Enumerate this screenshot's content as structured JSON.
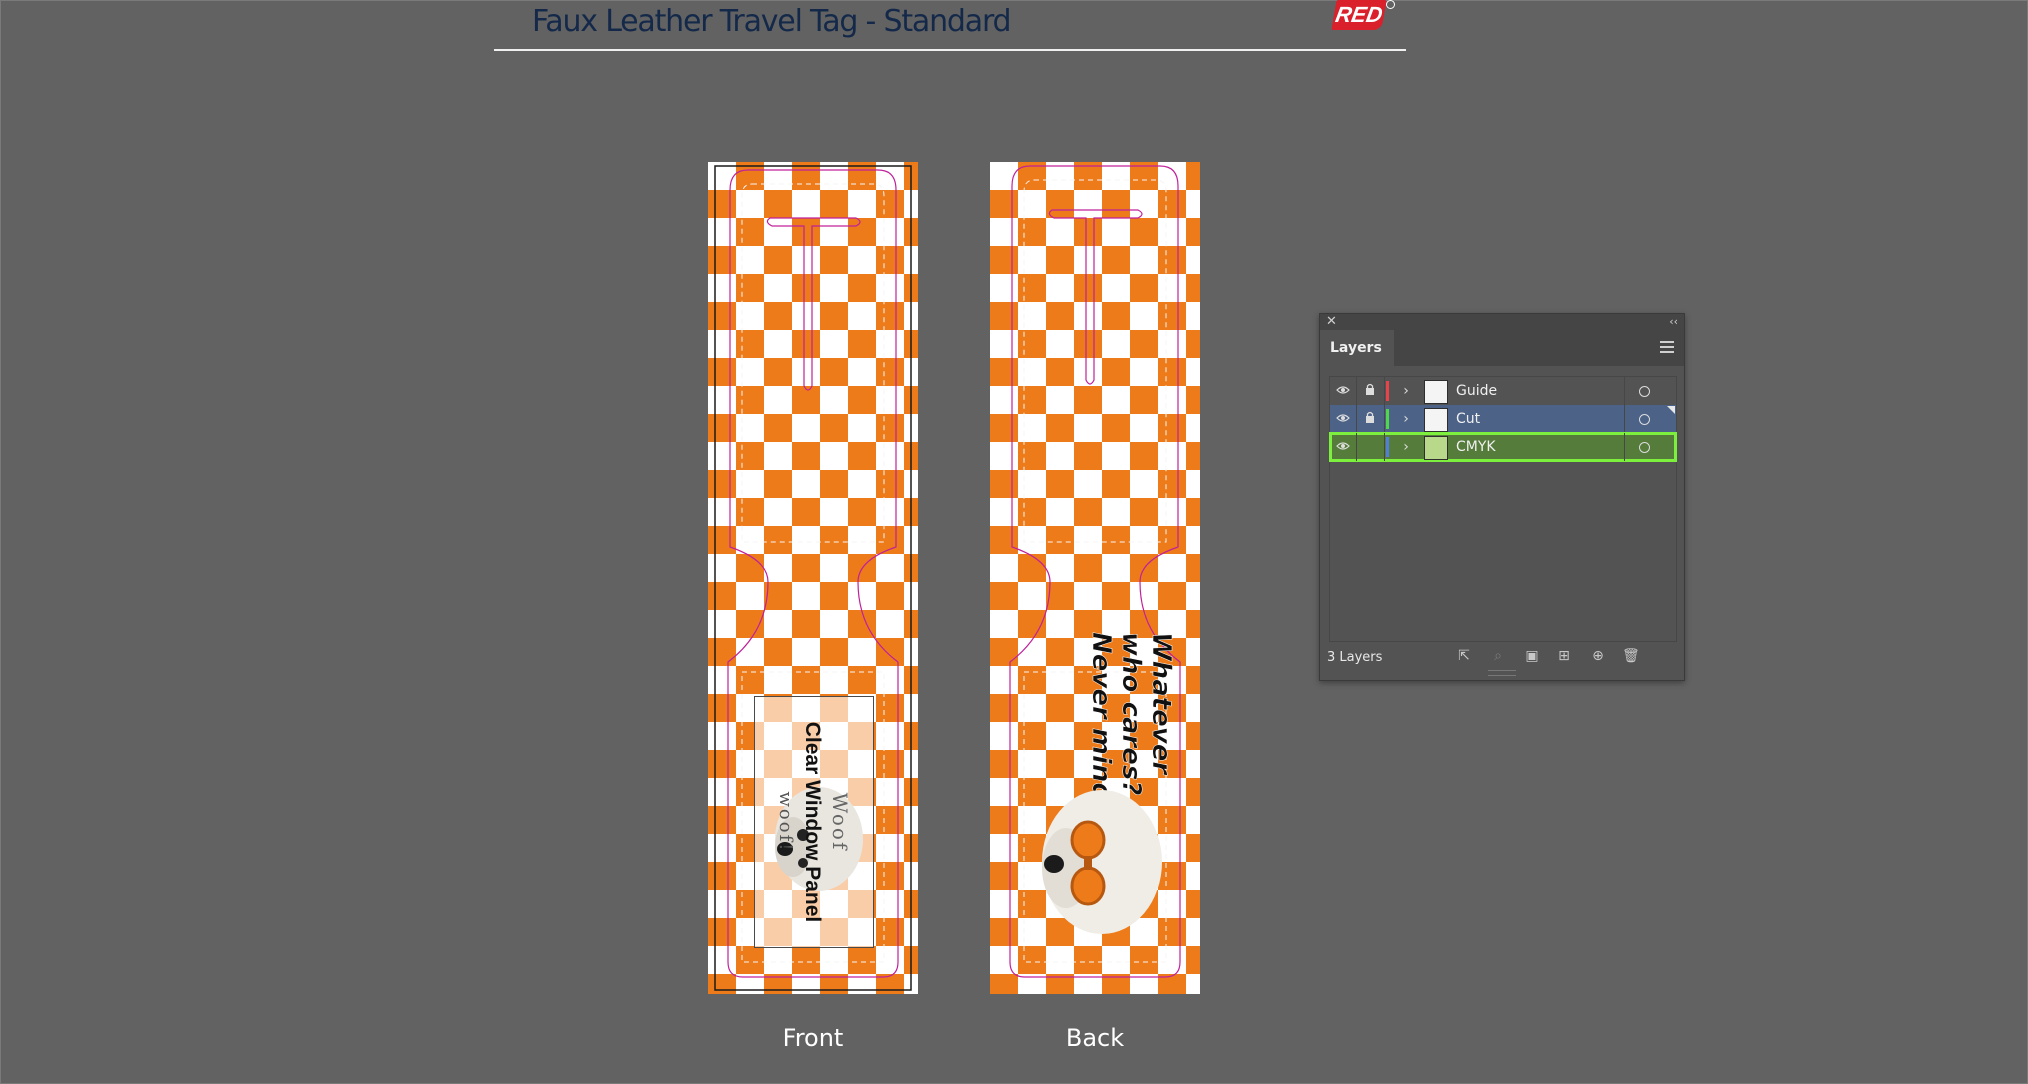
{
  "document": {
    "title": "Faux Leather Travel Tag - Standard",
    "logo_text": "RED"
  },
  "artboards": {
    "front": {
      "label": "Front",
      "window_panel_label": "Clear Window Panel",
      "woof_top": "Woof",
      "woof_bottom": "woof!"
    },
    "back": {
      "label": "Back",
      "quote_lines": [
        "Whatever",
        "who cares?",
        "Never mind"
      ]
    }
  },
  "layers_panel": {
    "tab_label": "Layers",
    "layers": [
      {
        "name": "Guide",
        "color": "#e8434b",
        "visible": true,
        "locked": true
      },
      {
        "name": "Cut",
        "color": "#4fd64f",
        "visible": true,
        "locked": true
      },
      {
        "name": "CMYK",
        "color": "#4f7fd6",
        "visible": true,
        "locked": false
      }
    ],
    "layer_count": "3 Layers"
  },
  "colors": {
    "canvas": "#626262",
    "checker_orange": "#ee7b1a",
    "cut_line": "#c0219a",
    "selected_highlight": "#7cf03c"
  }
}
